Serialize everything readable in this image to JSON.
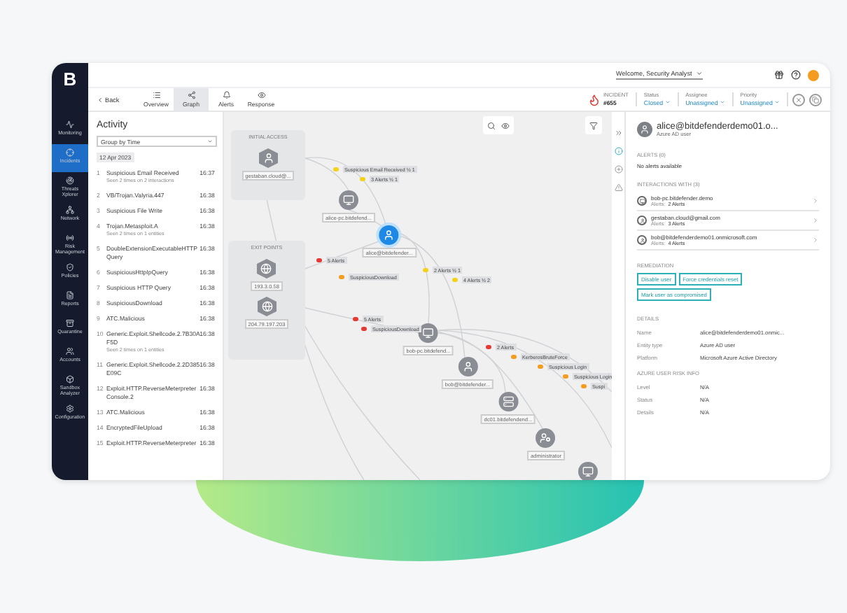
{
  "app": {
    "logo": "B"
  },
  "sidebar": {
    "items": [
      {
        "label": "Monitoring",
        "selected": false
      },
      {
        "label": "Incidents",
        "selected": true
      },
      {
        "label": "Threats Xplorer",
        "selected": false
      },
      {
        "label": "Network",
        "selected": false
      },
      {
        "label": "Risk Management",
        "selected": false
      },
      {
        "label": "Policies",
        "selected": false
      },
      {
        "label": "Reports",
        "selected": false
      },
      {
        "label": "Quarantine",
        "selected": false
      },
      {
        "label": "Accounts",
        "selected": false
      },
      {
        "label": "Sandbox Analyzer",
        "selected": false
      },
      {
        "label": "Configuration",
        "selected": false
      }
    ]
  },
  "topbar": {
    "greeting": "Welcome, Security Analyst"
  },
  "toolbar": {
    "back": "Back",
    "tabs": [
      {
        "label": "Overview",
        "selected": false
      },
      {
        "label": "Graph",
        "selected": true
      },
      {
        "label": "Alerts",
        "selected": false
      },
      {
        "label": "Response",
        "selected": false
      }
    ],
    "incident": {
      "label": "INCIDENT",
      "number": "#655"
    },
    "fields": [
      {
        "label": "Status",
        "value": "Closed"
      },
      {
        "label": "Assignee",
        "value": "Unassigned"
      },
      {
        "label": "Priority",
        "value": "Unassigned"
      }
    ]
  },
  "activity": {
    "title": "Activity",
    "group_by": "Group by Time",
    "date": "12 Apr 2023",
    "items": [
      {
        "index": "1",
        "name": "Suspicious Email Received",
        "time": "16:37",
        "detail": "Seen 2 times on 2 interactions"
      },
      {
        "index": "2",
        "name": "VB/Trojan.Valyria.447",
        "time": "16:38"
      },
      {
        "index": "3",
        "name": "Suspicious File Write",
        "time": "16:38"
      },
      {
        "index": "4",
        "name": "Trojan.Metasploit.A",
        "time": "16:38",
        "detail": "Seen 2 times on 1 entities"
      },
      {
        "index": "5",
        "name": "DoubleExtensionExecutableHTTP Query",
        "time": "16:38"
      },
      {
        "index": "6",
        "name": "SuspiciousHttpIpQuery",
        "time": "16:38"
      },
      {
        "index": "7",
        "name": "Suspicious HTTP Query",
        "time": "16:38"
      },
      {
        "index": "8",
        "name": "SuspiciousDownload",
        "time": "16:38"
      },
      {
        "index": "9",
        "name": "ATC.Malicious",
        "time": "16:38"
      },
      {
        "index": "10",
        "name": "Generic.Exploit.Shellcode.2.7B30A F5D",
        "time": "16:38",
        "detail": "Seen 2 times on 1 entities"
      },
      {
        "index": "11",
        "name": "Generic.Exploit.Shellcode.2.2D385 E09C",
        "time": "16:38"
      },
      {
        "index": "12",
        "name": "Exploit.HTTP.ReverseMeterpreter Console.2",
        "time": "16:38"
      },
      {
        "index": "13",
        "name": "ATC.Malicious",
        "time": "16:38"
      },
      {
        "index": "14",
        "name": "EncryptedFileUpload",
        "time": "16:38"
      },
      {
        "index": "15",
        "name": "Exploit.HTTP.ReverseMeterpreter",
        "time": "16:38"
      }
    ]
  },
  "graph": {
    "groups": [
      {
        "title": "INITIAL ACCESS",
        "nodes": [
          {
            "kind": "user",
            "label": "gestaban.cloud@..."
          }
        ]
      },
      {
        "title": "EXIT POINTS",
        "nodes": [
          {
            "kind": "ip",
            "label": "193.3.0.58"
          },
          {
            "kind": "ip",
            "label": "204.79.197.203"
          }
        ]
      }
    ],
    "nodes": [
      {
        "kind": "computer",
        "label": "alice-pc.bitdefend...",
        "selected": false
      },
      {
        "kind": "user",
        "label": "alice@bitdefender...",
        "selected": true
      },
      {
        "kind": "computer",
        "label": "bob-pc.bitdefend...",
        "selected": false
      },
      {
        "kind": "user",
        "label": "bob@bitdefender...",
        "selected": false
      },
      {
        "kind": "server",
        "label": "dc01.bitdefendend...",
        "selected": false
      },
      {
        "kind": "admin",
        "label": "administrator",
        "selected": false
      },
      {
        "kind": "computer",
        "selected": false
      }
    ],
    "alerts": [
      {
        "label": "Suspicious Email Received ½ 1",
        "color": "#f2d21b"
      },
      {
        "label": "3 Alerts ½ 1",
        "color": "#f2d21b"
      },
      {
        "label": "5 Alerts",
        "color": "#e53935"
      },
      {
        "label": "SuspiciousDownload",
        "color": "#f39c1f"
      },
      {
        "label": "2 Alerts ½ 1",
        "color": "#f2d21b"
      },
      {
        "label": "4 Alerts ½ 2",
        "color": "#f2d21b"
      },
      {
        "label": "5 Alerts",
        "color": "#e53935"
      },
      {
        "label": "SuspiciousDownload",
        "color": "#e53935"
      },
      {
        "label": "2 Alerts",
        "color": "#e53935"
      },
      {
        "label": "KerberosBruteForce",
        "color": "#f39c1f"
      },
      {
        "label": "Suspicious Login",
        "color": "#f39c1f"
      },
      {
        "label": "Suspicious Login",
        "color": "#f39c1f"
      },
      {
        "label": "Suspi",
        "color": "#f39c1f"
      }
    ]
  },
  "details": {
    "title": "alice@bitdefenderdemo01.o...",
    "subtitle": "Azure AD user",
    "alerts_heading": "ALERTS (0)",
    "alerts_empty": "No alerts available",
    "interactions_heading": "INTERACTIONS WITH (3)",
    "interactions": [
      {
        "kind": "computer",
        "name": "bob-pc.bitdefender.demo",
        "alerts_label": "Alerts:",
        "alerts": "2 Alerts"
      },
      {
        "kind": "user",
        "name": "gestaban.cloud@gmail.com",
        "alerts_label": "Alerts:",
        "alerts": "3 Alerts"
      },
      {
        "kind": "user",
        "name": "bob@bitdefenderdemo01.onmicrosoft.com",
        "alerts_label": "Alerts:",
        "alerts": "4 Alerts"
      }
    ],
    "remediation_heading": "REMEDIATION",
    "actions": [
      "Disable user",
      "Force credentials reset",
      "Mark user as compromised"
    ],
    "details_heading": "DETAILS",
    "properties": [
      {
        "label": "Name",
        "value": "alice@bitdefenderdemo01.onmic..."
      },
      {
        "label": "Entity type",
        "value": "Azure AD user"
      },
      {
        "label": "Platform",
        "value": "Microsoft Azure Active Directory"
      }
    ],
    "risk_heading": "AZURE USER RISK INFO",
    "risk": [
      {
        "label": "Level",
        "value": "N/A"
      },
      {
        "label": "Status",
        "value": "N/A"
      },
      {
        "label": "Details",
        "value": "N/A"
      }
    ]
  }
}
